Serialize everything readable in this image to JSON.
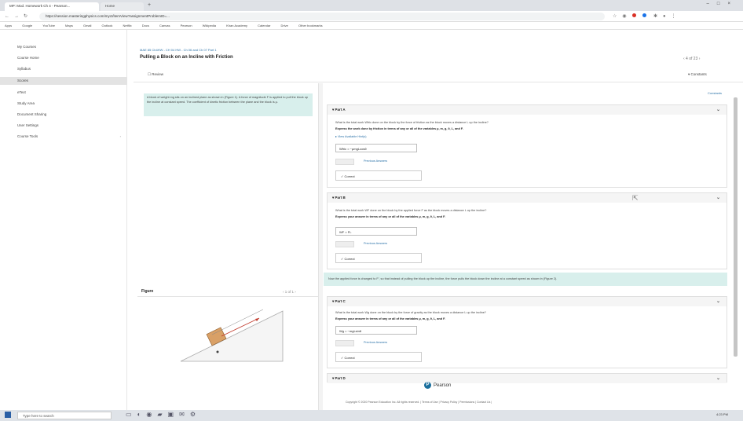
{
  "browser": {
    "tab_active": "MP: Mod. Homework Ch 4 - Pearson...",
    "tab_inactive": "Home",
    "window_controls": [
      "–",
      "□",
      "×"
    ],
    "url": "https://session.masteringphysics.com/myct/itemView?assignmentProblemID=...",
    "bookmarks": [
      "Apps",
      "Google",
      "YouTube",
      "Maps",
      "Gmail",
      "Outlook",
      "Netflix",
      "Docs",
      "Canvas",
      "Pearson",
      "Wikipedia",
      "Khan Academy",
      "Calendar",
      "Drive",
      "Other bookmarks"
    ]
  },
  "sidebar": {
    "items": [
      {
        "label": "My Courses",
        "active": false,
        "arrow": false
      },
      {
        "label": "Course Home",
        "active": false,
        "arrow": false
      },
      {
        "label": "Syllabus",
        "active": false,
        "arrow": false
      },
      {
        "label": "Scores",
        "active": true,
        "arrow": false
      },
      {
        "label": "eText",
        "active": false,
        "arrow": false
      },
      {
        "label": "Study Area",
        "active": false,
        "arrow": false
      },
      {
        "label": "Document Sharing",
        "active": false,
        "arrow": false
      },
      {
        "label": "User Settings",
        "active": false,
        "arrow": false
      },
      {
        "label": "Course Tools",
        "active": false,
        "arrow": true
      }
    ]
  },
  "header": {
    "breadcrumb": "MAE 85 Ch4HW - CH 04 HW - Ch 06 and Ch 07 Part 1",
    "title": "Pulling a Block on an Incline with Friction",
    "nav": "‹  4 of 23  ›",
    "review_label": "Review",
    "dropdown_label": "Constants"
  },
  "intro": {
    "text": "A block of weight mg sits on an inclined plane as shown in (Figure 1). A force of magnitude F is applied to pull the block up the incline at constant speed. The coefficient of kinetic friction between the plane and the block is μ."
  },
  "figure": {
    "label": "Figure",
    "pager": "‹  1 of 1  ›"
  },
  "constants_link": "Constants",
  "parts": [
    {
      "head": "Part A",
      "q1": "What is the total work Wfric done on the block by the force of friction as the block moves a distance L up the incline?",
      "q2": "Express the work done by friction in terms of any or all of the variables μ, m, g, θ, L, and F.",
      "hint": "View Available Hint(s)",
      "answer": "Wfric = −μmgLcosθ",
      "prev_link": "Previous Answers",
      "correct_label": "✓ Correct"
    },
    {
      "head": "Part B",
      "q1": "What is the total work WF done on the block by the applied force F as the block moves a distance L up the incline?",
      "q2": "Express your answer in terms of any or all of the variables μ, m, g, θ, L, and F.",
      "hint": "",
      "answer": "WF = FL",
      "prev_link": "Previous Answers",
      "correct_label": "✓ Correct"
    },
    {
      "head": "Part C",
      "q1": "What is the total work Wg done on the block by the force of gravity as the block moves a distance L up the incline?",
      "q2": "Express your answer in terms of any or all of the variables μ, m, g, θ, L, and F.",
      "hint": "",
      "answer": "Wg = −mgLsinθ",
      "prev_link": "Previous Answers",
      "correct_label": "✓ Correct"
    },
    {
      "head": "Part D",
      "q1": "",
      "q2": "",
      "hint": "",
      "answer": "",
      "prev_link": "",
      "correct_label": ""
    }
  ],
  "mid_banner": "Now the applied force is changed to F′, so that instead of pulling the block up the incline, the force pulls the block down the incline at a constant speed as shown in (Figure 2).",
  "footer": {
    "brand": "Pearson",
    "copyright": "Copyright © 2020 Pearson Education Inc. All rights reserved. | Terms of Use | Privacy Policy | Permissions | Contact Us |"
  },
  "taskbar": {
    "search_placeholder": "Type here to search",
    "clock": "4:23 PM"
  },
  "colors": {
    "accent": "#2b72a8",
    "banner": "#d8efec",
    "block": "#d9a066"
  }
}
